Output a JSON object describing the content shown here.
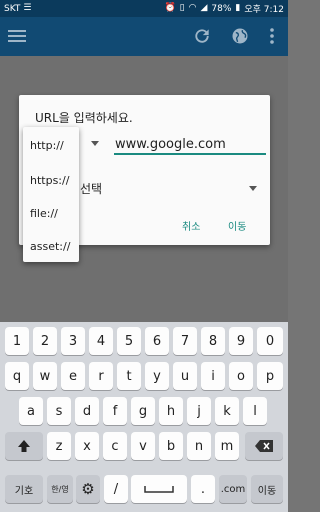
{
  "status_bar": {
    "carrier": "SKT",
    "battery_percent": "78%",
    "time": "오후 7:12"
  },
  "app_bar": {
    "icons": [
      "menu-icon",
      "refresh-icon",
      "globe-icon",
      "more-vert-icon"
    ]
  },
  "dialog": {
    "title": "URL을 입력하세요.",
    "url_value": "www.google.com",
    "select_label": "선택",
    "cancel_label": "취소",
    "go_label": "이동"
  },
  "protocol_dropdown": {
    "options": [
      "http://",
      "https://",
      "file://",
      "asset://"
    ]
  },
  "keyboard": {
    "row_numbers": [
      "1",
      "2",
      "3",
      "4",
      "5",
      "6",
      "7",
      "8",
      "9",
      "0"
    ],
    "row_top": [
      "q",
      "w",
      "e",
      "r",
      "t",
      "y",
      "u",
      "i",
      "o",
      "p"
    ],
    "row_mid": [
      "a",
      "s",
      "d",
      "f",
      "g",
      "h",
      "j",
      "k",
      "l"
    ],
    "row_bottom": [
      "z",
      "x",
      "c",
      "v",
      "b",
      "n",
      "m"
    ],
    "symbols_label": "기호",
    "lang_label": "한/영",
    "slash_label": "/",
    "period_label": ".",
    "com_label": ".com",
    "go_key_label": "이동"
  },
  "colors": {
    "status_bar": "#0b3a5c",
    "app_bar": "#114a73",
    "accent": "#1a8a80",
    "keyboard_bg": "#d3d6db"
  }
}
